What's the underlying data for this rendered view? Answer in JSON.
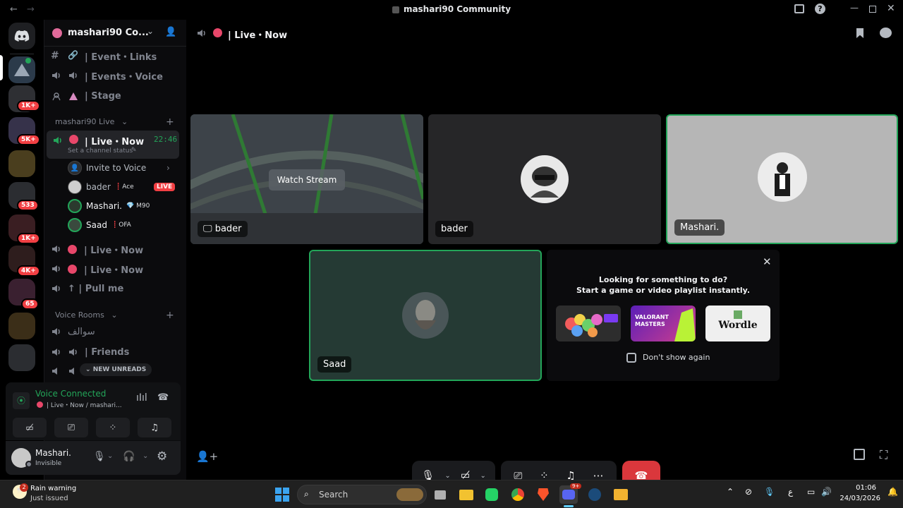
{
  "window": {
    "title": "mashari90 Community"
  },
  "guild": {
    "name": "mashari90 Co..."
  },
  "channels_top": [
    {
      "label": "| Event・Links"
    },
    {
      "label": "| Events・Voice"
    },
    {
      "label": "| Stage"
    }
  ],
  "category_live": {
    "label": "mashari90 Live"
  },
  "active_channel": {
    "label": "| Live・Now",
    "timer": "22:46",
    "status": "Set a channel status"
  },
  "invite": {
    "label": "Invite to Voice"
  },
  "members": [
    {
      "name": "bader",
      "tag": "Ace",
      "live": "LIVE"
    },
    {
      "name": "Mashari.",
      "tag": "M90"
    },
    {
      "name": "Saad",
      "tag": "OFA"
    }
  ],
  "channels_mid": [
    {
      "label": "| Live・Now"
    },
    {
      "label": "| Live・Now"
    },
    {
      "label": "↑ | Pull me"
    }
  ],
  "category_voice": {
    "label": "Voice Rooms"
  },
  "channels_voice": [
    {
      "label": "سوالف"
    },
    {
      "label": "| Friends"
    }
  ],
  "new_unreads": "NEW UNREADS",
  "voice_panel": {
    "title": "Voice Connected",
    "subtitle": "| Live・Now / mashari..."
  },
  "user_panel": {
    "name": "Mashari.",
    "status": "Invisible"
  },
  "header": {
    "channel": "| Live・Now"
  },
  "tiles": {
    "stream": {
      "watch_label": "Watch Stream",
      "name": "bader"
    },
    "bader": {
      "name": "bader"
    },
    "mashari": {
      "name": "Mashari."
    },
    "saad": {
      "name": "Saad"
    }
  },
  "activity": {
    "line1": "Looking for something to do?",
    "line2": "Start a game or video playlist instantly.",
    "wordle": "Wordle",
    "valorant": "VALORANT MASTERS",
    "dont_show": "Don't show again"
  },
  "server_badges": [
    "1K+",
    "5K+",
    "533",
    "1K+",
    "4K+",
    "65"
  ],
  "taskbar": {
    "search": "Search",
    "notif_title": "Rain warning",
    "notif_sub": "Just issued",
    "notif_count": "2",
    "discord_badge": "9+",
    "lang": "ع",
    "time": "01:06",
    "date": "24/03/2026"
  },
  "colors": {
    "accent": "#23a559",
    "danger": "#da373c",
    "live": "#f23f43",
    "blurple": "#5865f2"
  }
}
